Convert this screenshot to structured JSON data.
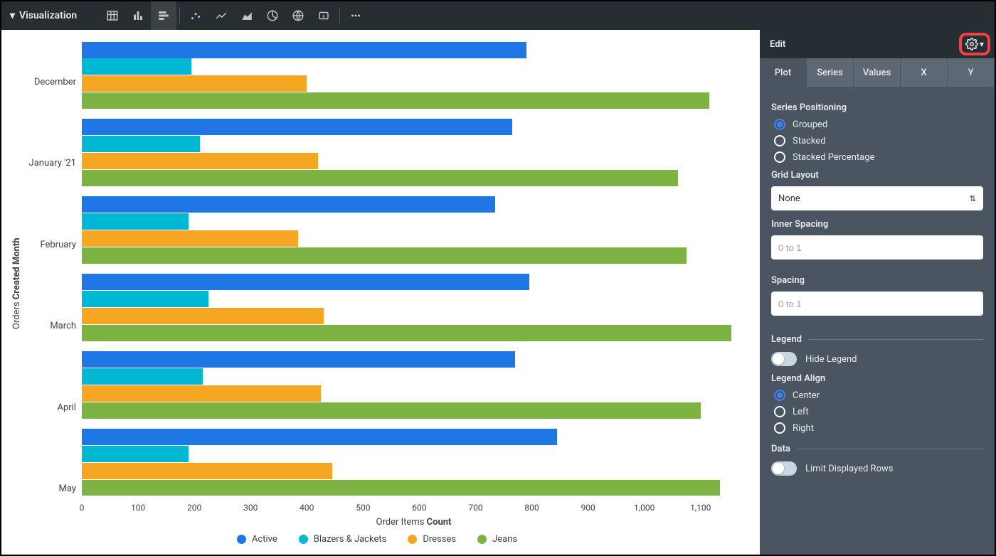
{
  "toolbar": {
    "title": "Visualization",
    "chart_type_icons": [
      "table",
      "column",
      "bar",
      "scatter",
      "line",
      "area",
      "pie",
      "map",
      "single-value",
      "more"
    ],
    "active_icon_index": 2
  },
  "edit": {
    "title": "Edit",
    "tabs": [
      "Plot",
      "Series",
      "Values",
      "X",
      "Y"
    ],
    "active_tab": 0,
    "series_positioning": {
      "label": "Series Positioning",
      "options": [
        "Grouped",
        "Stacked",
        "Stacked Percentage"
      ],
      "selected": 0
    },
    "grid_layout": {
      "label": "Grid Layout",
      "value": "None"
    },
    "inner_spacing": {
      "label": "Inner Spacing",
      "placeholder": "0 to 1",
      "value": ""
    },
    "spacing": {
      "label": "Spacing",
      "placeholder": "0 to 1",
      "value": ""
    },
    "legend_section": "Legend",
    "hide_legend": {
      "label": "Hide Legend",
      "value": false
    },
    "legend_align": {
      "label": "Legend Align",
      "options": [
        "Center",
        "Left",
        "Right"
      ],
      "selected": 0
    },
    "data_section": "Data",
    "limit_rows": {
      "label": "Limit Displayed Rows",
      "value": false
    }
  },
  "colors": {
    "active": "#1f77e6",
    "blazers": "#00b8d4",
    "dresses": "#f5a623",
    "jeans": "#7cb342"
  },
  "chart_data": {
    "type": "bar",
    "orientation": "horizontal",
    "xlabel_html": "Order Items <b>Count</b>",
    "ylabel_html": "Orders <b>Created Month</b>",
    "x_ticks": [
      0,
      100,
      200,
      300,
      400,
      500,
      600,
      700,
      800,
      900,
      "1,000",
      "1,100"
    ],
    "x_max": 1180,
    "categories": [
      "December",
      "January '21",
      "February",
      "March",
      "April",
      "May"
    ],
    "series": [
      {
        "name": "Active",
        "color": "#1f77e6",
        "values": [
          790,
          765,
          735,
          795,
          770,
          845
        ]
      },
      {
        "name": "Blazers & Jackets",
        "color": "#00b8d4",
        "values": [
          195,
          210,
          190,
          225,
          215,
          190
        ]
      },
      {
        "name": "Dresses",
        "color": "#f5a623",
        "values": [
          400,
          420,
          385,
          430,
          425,
          445
        ]
      },
      {
        "name": "Jeans",
        "color": "#7cb342",
        "values": [
          1115,
          1060,
          1075,
          1155,
          1100,
          1135
        ]
      }
    ]
  }
}
